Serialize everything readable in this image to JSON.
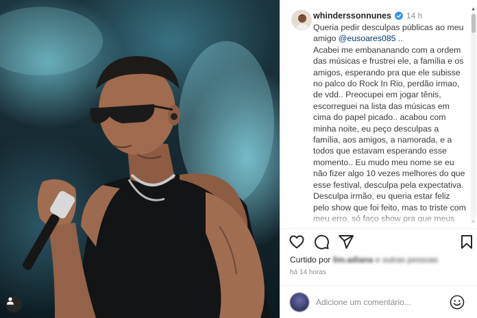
{
  "post": {
    "username": "whinderssonnunes",
    "time": "14 h",
    "caption_intro": "Queria pedir desculpas públicas ao meu amigo ",
    "mention": "@eusoares085",
    "caption_after_mention": " ..",
    "caption_body": "Acabei me embananando com a ordem das músicas e frustrei ele, a família e os amigos, esperando pra que ele subisse no palco do Rock In Rio, perdão irmao, de vdd.. Preocupei em jogar tênis, escorreguei na lista das músicas em cima do papel picado.. acabou com minha noite, eu peço desculpas a família, aos amigos, a namorada, e a todos que estavam esperando esse momento.. Eu mudo meu nome se eu não fizer algo 10 vezes melhores do que esse festival, desculpa pela expectativa. Desculpa irmão, eu queria estar feliz pelo show que foi feito, mas to triste com meu erro, só faço show pra que meus amigos possam ter a sensação que eu tenho, se isso não"
  },
  "engagement": {
    "liked_prefix": "Curtido por ",
    "liked_user": "lim.adiana",
    "liked_suffix": " e outras pessoas",
    "post_age": "há 14 horas"
  },
  "comment": {
    "placeholder": "Adicione um comentário..."
  },
  "icons": {
    "like": "heart-icon",
    "comment": "comment-bubble-icon",
    "share": "paper-plane-icon",
    "save": "bookmark-icon",
    "emoji": "smiley-icon",
    "verified": "verified-badge-icon",
    "photo_user": "user-tag-icon"
  },
  "colors": {
    "verified": "#3897f0",
    "mention": "#00376b",
    "muted": "#8e8e8e",
    "text": "#262626"
  }
}
